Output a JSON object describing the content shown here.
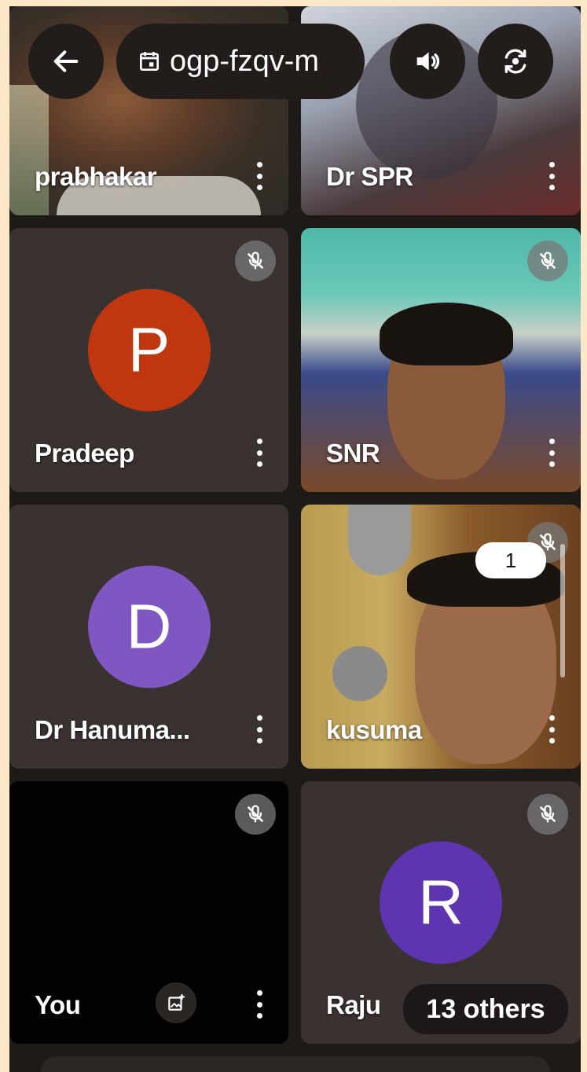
{
  "meeting": {
    "code": "ogp-fzqv-m"
  },
  "tiles": [
    {
      "name": "prabhakar"
    },
    {
      "name": "Dr SPR"
    },
    {
      "name": "Pradeep",
      "initial": "P",
      "color": "#c0360e"
    },
    {
      "name": "SNR"
    },
    {
      "name": "Dr Hanuma...",
      "initial": "D",
      "color": "#7e57c2"
    },
    {
      "name": "kusuma"
    },
    {
      "name": "You"
    },
    {
      "name": "Raju",
      "initial": "R",
      "color": "#5e35b1"
    }
  ],
  "scroll_badge": "1",
  "others_label": "13 others",
  "icons": {
    "back": "arrow-left-icon",
    "calendar": "calendar-icon",
    "speaker": "speaker-icon",
    "camera_switch": "camera-switch-icon",
    "mic_off": "mic-off-icon",
    "more": "more-vert-icon",
    "add_photo": "add-photo-icon"
  }
}
